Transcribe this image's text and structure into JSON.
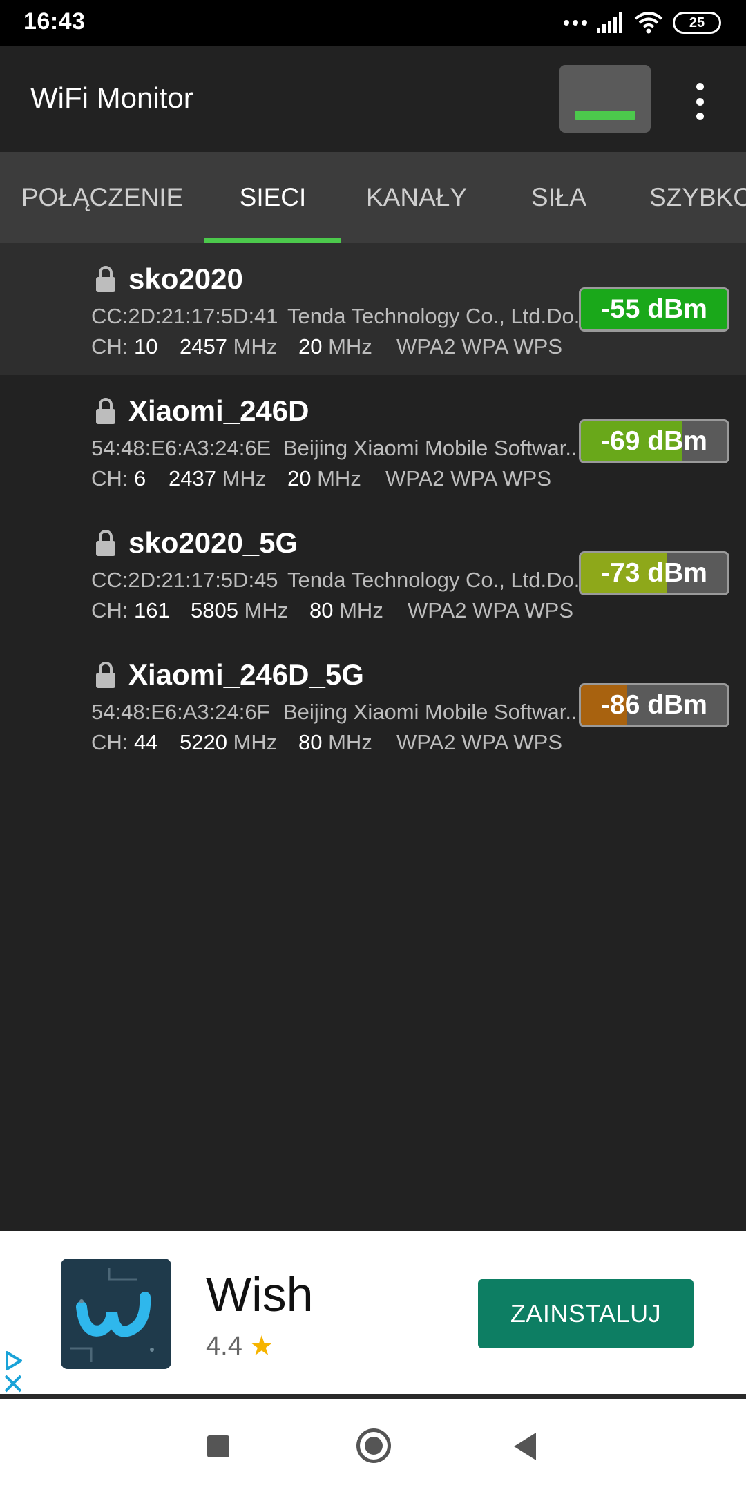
{
  "status_bar": {
    "time": "16:43",
    "battery": "25"
  },
  "app_bar": {
    "title": "WiFi Monitor"
  },
  "tabs": [
    {
      "label": "POŁĄCZENIE",
      "active": false
    },
    {
      "label": "SIECI",
      "active": true
    },
    {
      "label": "KANAŁY",
      "active": false
    },
    {
      "label": "SIŁA",
      "active": false
    },
    {
      "label": "SZYBKO",
      "active": false
    }
  ],
  "colors": {
    "accent": "#4cc94c",
    "signal_strong": "#1aa81a",
    "signal_good": "#69a81a",
    "signal_fair": "#8ea81a",
    "signal_weak": "#a8620f",
    "install_button": "#0d7e63"
  },
  "networks": [
    {
      "ssid": "sko2020",
      "bssid": "CC:2D:21:17:5D:41",
      "vendor": "Tenda Technology Co., Ltd.Do...",
      "ch_label": "CH:",
      "ch": "10",
      "freq": "2457",
      "freq_unit": "MHz",
      "width": "20",
      "width_unit": "MHz",
      "security": "WPA2 WPA WPS",
      "signal": "-55 dBm",
      "signal_level": 1.0,
      "selected": true
    },
    {
      "ssid": "Xiaomi_246D",
      "bssid": "54:48:E6:A3:24:6E",
      "vendor": "Beijing Xiaomi Mobile Softwar...",
      "ch_label": "CH:",
      "ch": "6",
      "freq": "2437",
      "freq_unit": "MHz",
      "width": "20",
      "width_unit": "MHz",
      "security": "WPA2 WPA WPS",
      "signal": "-69 dBm",
      "signal_level": 0.69,
      "selected": false
    },
    {
      "ssid": "sko2020_5G",
      "bssid": "CC:2D:21:17:5D:45",
      "vendor": "Tenda Technology Co., Ltd.Do...",
      "ch_label": "CH:",
      "ch": "161",
      "freq": "5805",
      "freq_unit": "MHz",
      "width": "80",
      "width_unit": "MHz",
      "security": "WPA2 WPA WPS",
      "signal": "-73 dBm",
      "signal_level": 0.59,
      "selected": false
    },
    {
      "ssid": "Xiaomi_246D_5G",
      "bssid": "54:48:E6:A3:24:6F",
      "vendor": "Beijing Xiaomi Mobile Softwar...",
      "ch_label": "CH:",
      "ch": "44",
      "freq": "5220",
      "freq_unit": "MHz",
      "width": "80",
      "width_unit": "MHz",
      "security": "WPA2 WPA WPS",
      "signal": "-86 dBm",
      "signal_level": 0.31,
      "selected": false
    }
  ],
  "ad": {
    "app_name": "Wish",
    "rating": "4.4",
    "install_label": "ZAINSTALUJ"
  }
}
